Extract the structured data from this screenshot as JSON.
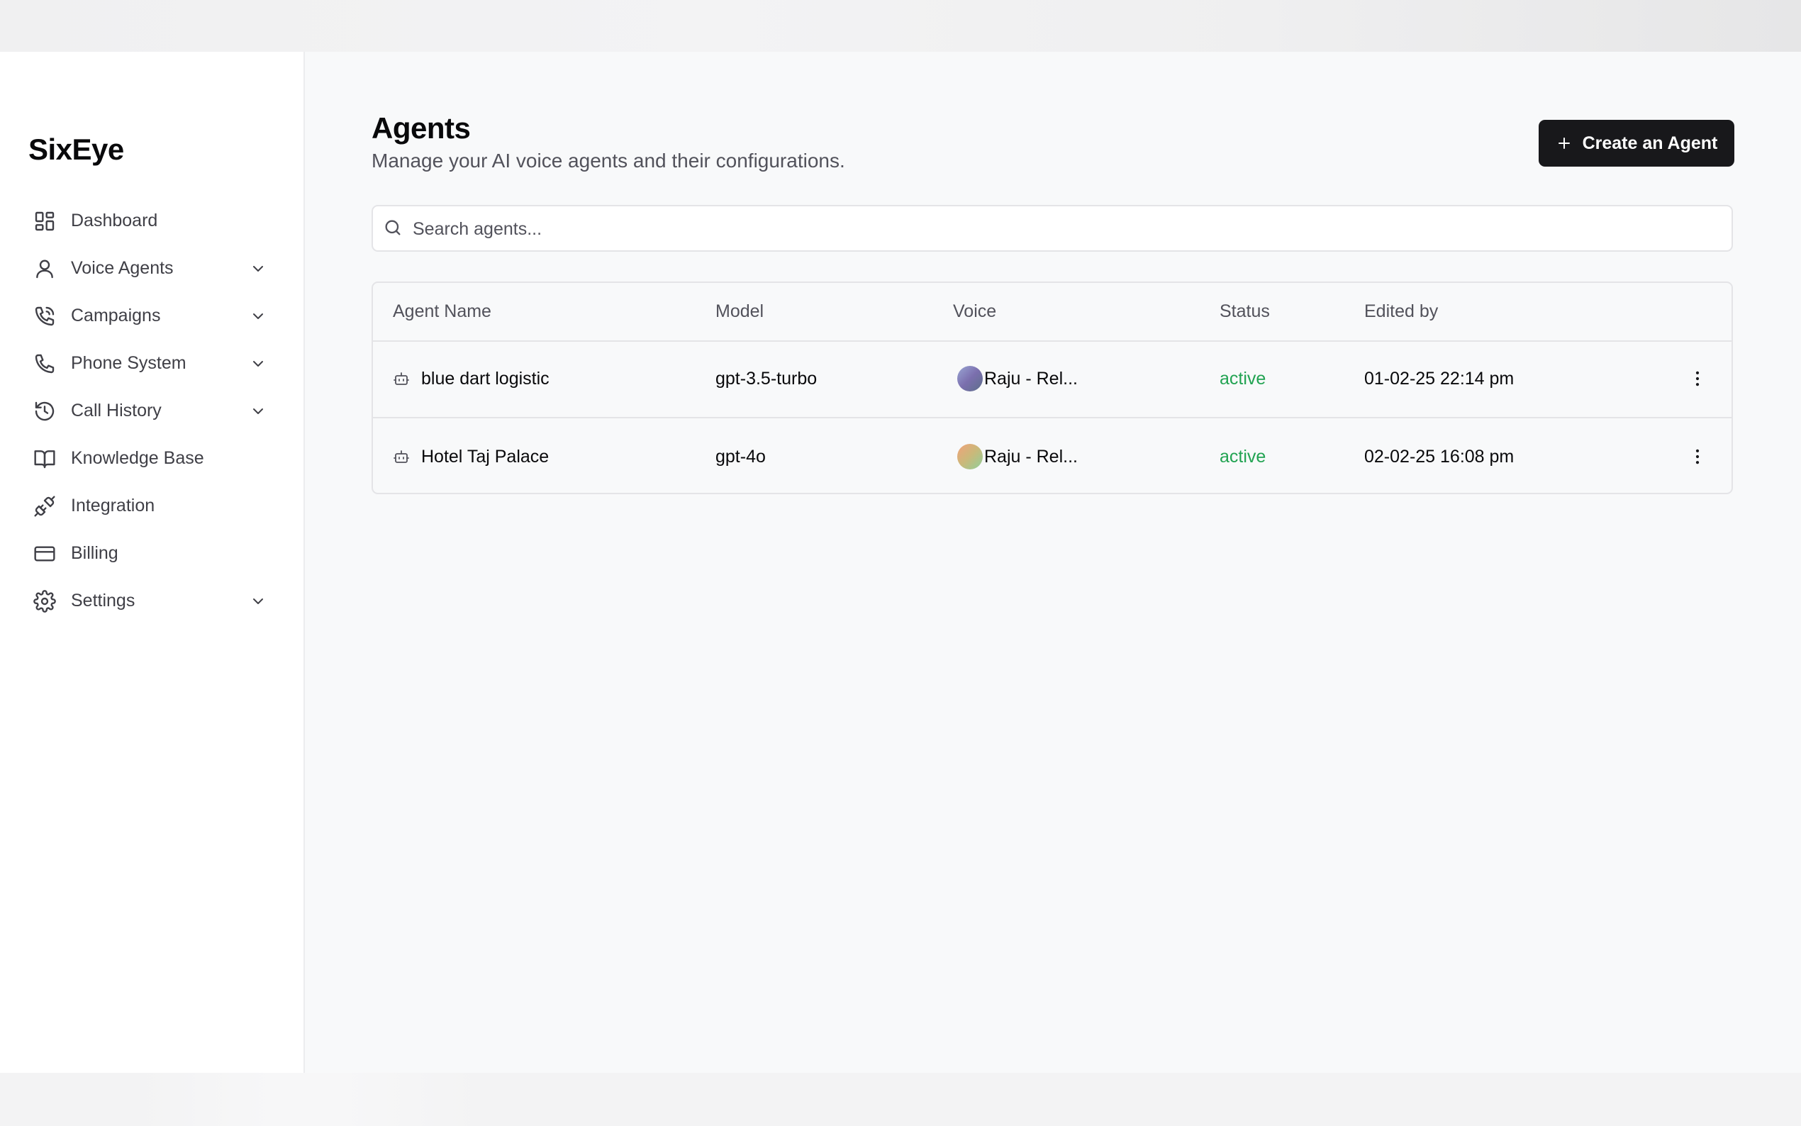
{
  "app": {
    "brand": "SixEye"
  },
  "sidebar": {
    "items": [
      {
        "label": "Dashboard",
        "icon": "dashboard-icon",
        "has_chevron": false
      },
      {
        "label": "Voice Agents",
        "icon": "user-icon",
        "has_chevron": true
      },
      {
        "label": "Campaigns",
        "icon": "phone-call-icon",
        "has_chevron": true
      },
      {
        "label": "Phone System",
        "icon": "phone-icon",
        "has_chevron": true
      },
      {
        "label": "Call History",
        "icon": "history-icon",
        "has_chevron": true
      },
      {
        "label": "Knowledge Base",
        "icon": "book-open-icon",
        "has_chevron": false
      },
      {
        "label": "Integration",
        "icon": "plug-icon",
        "has_chevron": false
      },
      {
        "label": "Billing",
        "icon": "credit-card-icon",
        "has_chevron": false
      },
      {
        "label": "Settings",
        "icon": "gear-icon",
        "has_chevron": true
      }
    ]
  },
  "page": {
    "title": "Agents",
    "subtitle": "Manage your AI voice agents and their configurations.",
    "create_button_label": "Create an Agent"
  },
  "search": {
    "placeholder": "Search agents...",
    "value": ""
  },
  "table": {
    "columns": [
      "Agent Name",
      "Model",
      "Voice",
      "Status",
      "Edited by"
    ],
    "rows": [
      {
        "agent_name": "blue dart logistic",
        "model": "gpt-3.5-turbo",
        "voice": "Raju - Rel...",
        "status": "active",
        "edited_by": "01-02-25 22:14 pm"
      },
      {
        "agent_name": "Hotel Taj Palace",
        "model": "gpt-4o",
        "voice": "Raju - Rel...",
        "status": "active",
        "edited_by": "02-02-25 16:08 pm"
      }
    ]
  },
  "colors": {
    "primary_button": "#18181b",
    "status_active": "#22a352",
    "sidebar_bg": "#ffffff",
    "main_bg": "#f8f9fa"
  }
}
